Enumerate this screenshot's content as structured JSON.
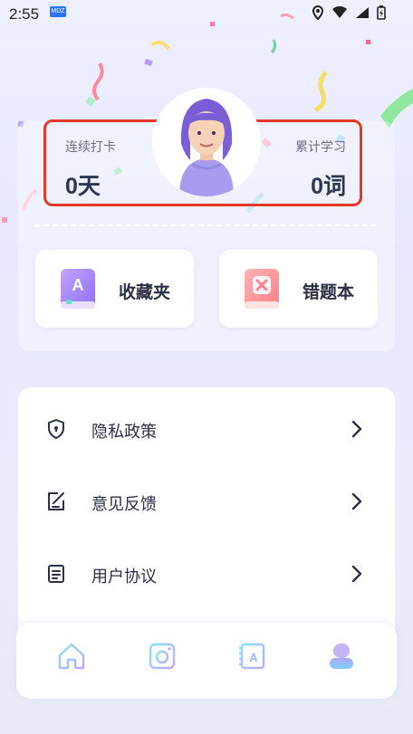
{
  "status_bar": {
    "time": "2:55",
    "badge_text": "MDZ"
  },
  "stats": {
    "streak_label": "连续打卡",
    "streak_value": "0天",
    "learned_label": "累计学习",
    "learned_value": "0词"
  },
  "quick_actions": [
    {
      "label": "收藏夹",
      "icon": "bookmark-book-icon",
      "icon_letter": "A",
      "color": "#b98cff"
    },
    {
      "label": "错题本",
      "icon": "error-book-icon",
      "color": "#ff8f95"
    }
  ],
  "menu": [
    {
      "label": "隐私政策",
      "icon": "shield-icon"
    },
    {
      "label": "意见反馈",
      "icon": "feedback-edit-icon"
    },
    {
      "label": "用户协议",
      "icon": "document-icon"
    }
  ],
  "bottom_nav": [
    {
      "icon": "home-icon",
      "active": false
    },
    {
      "icon": "camera-icon",
      "active": false
    },
    {
      "icon": "vocabulary-book-icon",
      "icon_letter": "A",
      "active": false
    },
    {
      "icon": "profile-icon",
      "active": true
    }
  ],
  "colors": {
    "highlight_border": "#e13a2b",
    "accent_blue": "#4aa8ff",
    "accent_purple": "#9a7cff"
  }
}
